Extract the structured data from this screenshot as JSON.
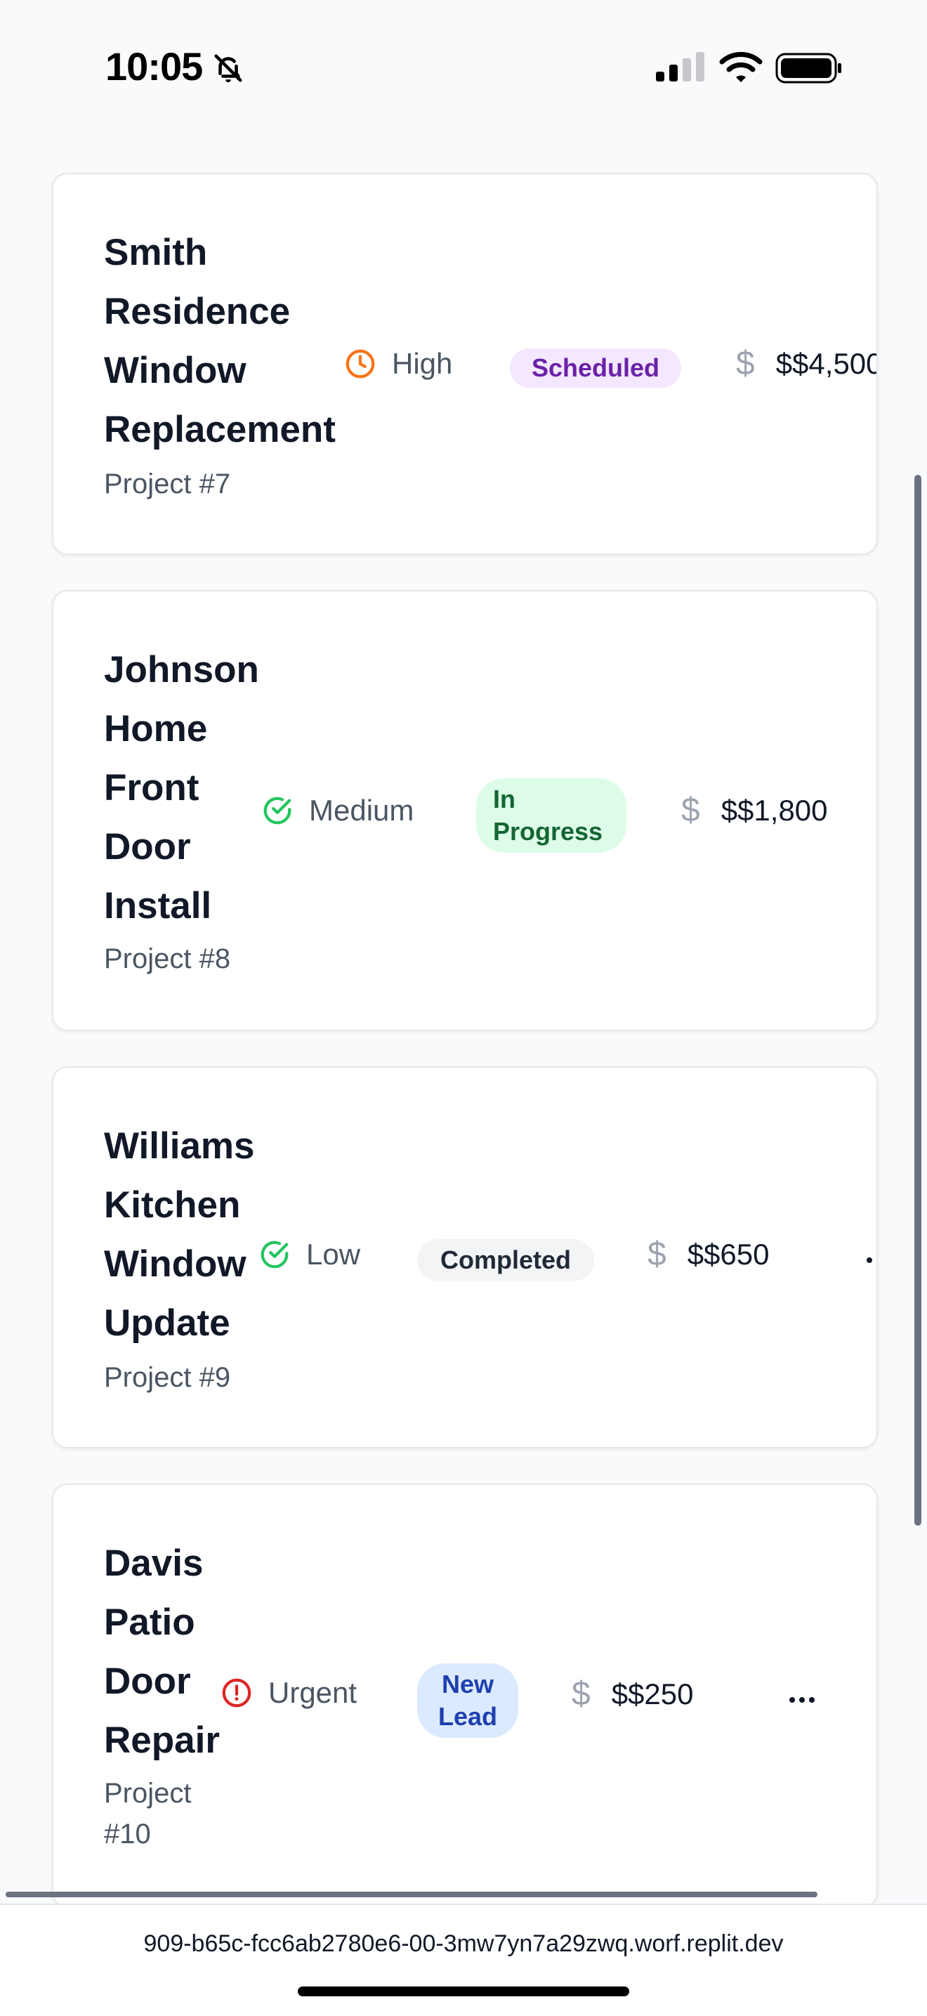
{
  "status_bar": {
    "time": "10:05"
  },
  "projects": [
    {
      "title_lines": [
        "Smith",
        "Residence",
        "Window",
        "Replacement"
      ],
      "project_number": "Project #7",
      "priority": "High",
      "priority_icon": "clock-icon",
      "priority_color": "#f97316",
      "status": "Scheduled",
      "amount": "$$4,500"
    },
    {
      "title_lines": [
        "Johnson",
        "Home",
        "Front",
        "Door",
        "Install"
      ],
      "project_number": "Project #8",
      "priority": "Medium",
      "priority_icon": "check-circle-icon",
      "priority_color": "#22c55e",
      "status": "In Progress",
      "amount": "$$1,800"
    },
    {
      "title_lines": [
        "Williams",
        "Kitchen",
        "Window",
        "Update"
      ],
      "project_number": "Project #9",
      "priority": "Low",
      "priority_icon": "check-circle-icon",
      "priority_color": "#22c55e",
      "status": "Completed",
      "amount": "$$650"
    },
    {
      "title_lines": [
        "Davis",
        "Patio",
        "Door",
        "Repair"
      ],
      "project_number_lines": [
        "Project",
        "#10"
      ],
      "priority": "Urgent",
      "priority_icon": "alert-circle-icon",
      "priority_color": "#dc2626",
      "status": "New Lead",
      "amount": "$$250"
    }
  ],
  "currency_symbol": "$",
  "browser": {
    "url": "909-b65c-fcc6ab2780e6-00-3mw7yn7a29zwq.worf.replit.dev"
  }
}
